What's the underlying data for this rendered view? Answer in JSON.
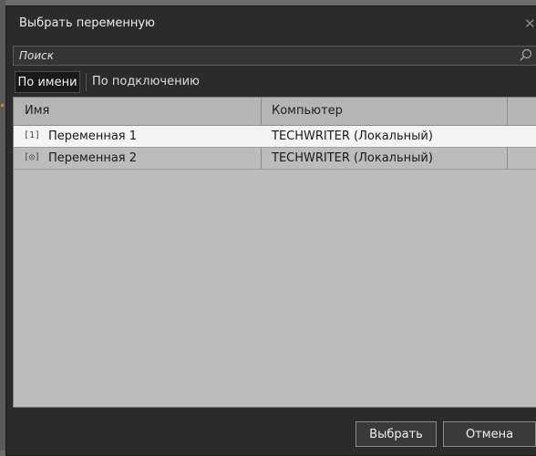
{
  "window": {
    "title": "Выбрать переменную"
  },
  "search": {
    "placeholder": "Поиск"
  },
  "tabs": [
    {
      "label": "По имени",
      "active": true
    },
    {
      "label": "По подключению",
      "active": false
    }
  ],
  "table": {
    "columns": [
      "Имя",
      "Компьютер"
    ],
    "rows": [
      {
        "icon_glyph": "[1]",
        "icon_name": "numeric-variable-icon",
        "name": "Переменная 1",
        "computer": "TECHWRITER (Локальный)",
        "selected": true
      },
      {
        "icon_glyph": "[◎]",
        "icon_name": "state-variable-icon",
        "name": "Переменная 2",
        "computer": "TECHWRITER (Локальный)",
        "selected": false
      }
    ]
  },
  "buttons": {
    "select": "Выбрать",
    "cancel": "Отмена"
  },
  "colors": {
    "dialog_bg": "#2b2b2b",
    "grid_bg": "#bcbcbc",
    "selected_row": "#f4f4f4",
    "button_bg": "#3a3a3a"
  }
}
